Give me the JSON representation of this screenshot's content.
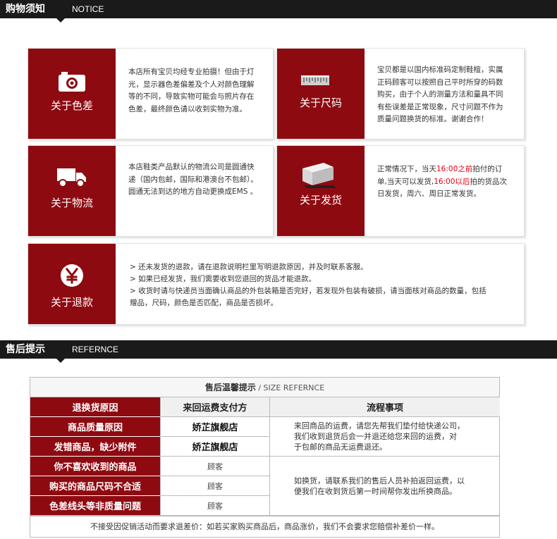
{
  "notice_header": {
    "cn": "购物须知",
    "en": "NOTICE"
  },
  "cards": {
    "color": {
      "label": "关于色差",
      "icon": "camera-icon",
      "lines": [
        "本店所有宝贝均经专业拍摄！但由于灯",
        "光，显示器色差偏差及个人对颜色理解",
        "等的不同，导致实物可能会与照片存在",
        "色差，最终颜色请以收到实物为准。"
      ]
    },
    "size": {
      "label": "关于尺码",
      "icon": "ruler-icon",
      "lines": [
        "宝贝都是以国内标准码定制鞋楦，实属",
        "正码顾客可以按照自己平时所穿的码数",
        "购买，由于个人的测量方法和量具不同",
        "有些误差是正常现象，尺寸问题不作为",
        "质量问题换货的标准。谢谢合作！"
      ]
    },
    "logistics": {
      "label": "关于物流",
      "icon": "truck-icon",
      "lines": [
        "本店鞋类产品默认的物流公司是圆通快",
        "递（国内包邮，国际和港澳台不包邮）。",
        "圆通无法到达的地方自动更换成EMS 。"
      ]
    },
    "shipping": {
      "label": "关于发货",
      "icon": "box-icon",
      "line1_a": "正常情况下，当天",
      "line1_hl": "16:00之前",
      "line1_b": "拍付的订",
      "line2_a": "单,当天可以发货,",
      "line2_hl": "16:00以后",
      "line2_b": "拍的货品次",
      "line3": "日发货，周六、周日正常发货。"
    },
    "refund": {
      "label": "关于退款",
      "icon": "yen-icon",
      "lines": [
        "> 还未发货的退款，请在退款说明栏里写明退款原因，并及时联系客服。",
        "> 如果已经发货，我们需要收到您退回的货品才能退款。",
        "> 收货时请与快递员当面确认商品的外包装箱是否完好，若发现外包装有破损，请当面核对商品的数量，包括",
        "赠品，尺码，颜色是否匹配，商品是否损坏。"
      ]
    }
  },
  "after_sales_header": {
    "cn": "售后提示",
    "en": "REFERNCE"
  },
  "table": {
    "caption_cn": "售后温馨提示",
    "caption_en": " / SIZE REFERNCE",
    "headers": [
      "退换货原因",
      "来回运费支付方",
      "流程事项"
    ],
    "rows": [
      {
        "reason": "商品质量原因",
        "payer": "娇芷旗舰店"
      },
      {
        "reason": "发错商品，缺少附件",
        "payer": "娇芷旗舰店"
      },
      {
        "reason": "你不喜欢收到的商品",
        "payer": "顾客"
      },
      {
        "reason": "购买的商品尺码不合适",
        "payer": "顾客"
      },
      {
        "reason": "色差线头等非质量问题",
        "payer": "顾客"
      }
    ],
    "process_store": [
      "来回商品的运费，请您先帮我们垫付给快递公司，",
      "我们收到退货后会一并退还给您来回的运费，对",
      "于包邮的商品无运费退还。"
    ],
    "process_customer": [
      "如换货，请联系我们的售后人员补拍返回运费，以",
      "便我们在收到货后第一时间帮你发出所换商品。"
    ],
    "footer": "不接受因促销活动而要求退差价：如若买家购买商品后，商品涨价，我们不会要求您赔偿补差价一样。"
  },
  "colors": {
    "brand_red": "#8e0a11",
    "highlight": "#e60012",
    "bar": "#1a1a1a"
  }
}
